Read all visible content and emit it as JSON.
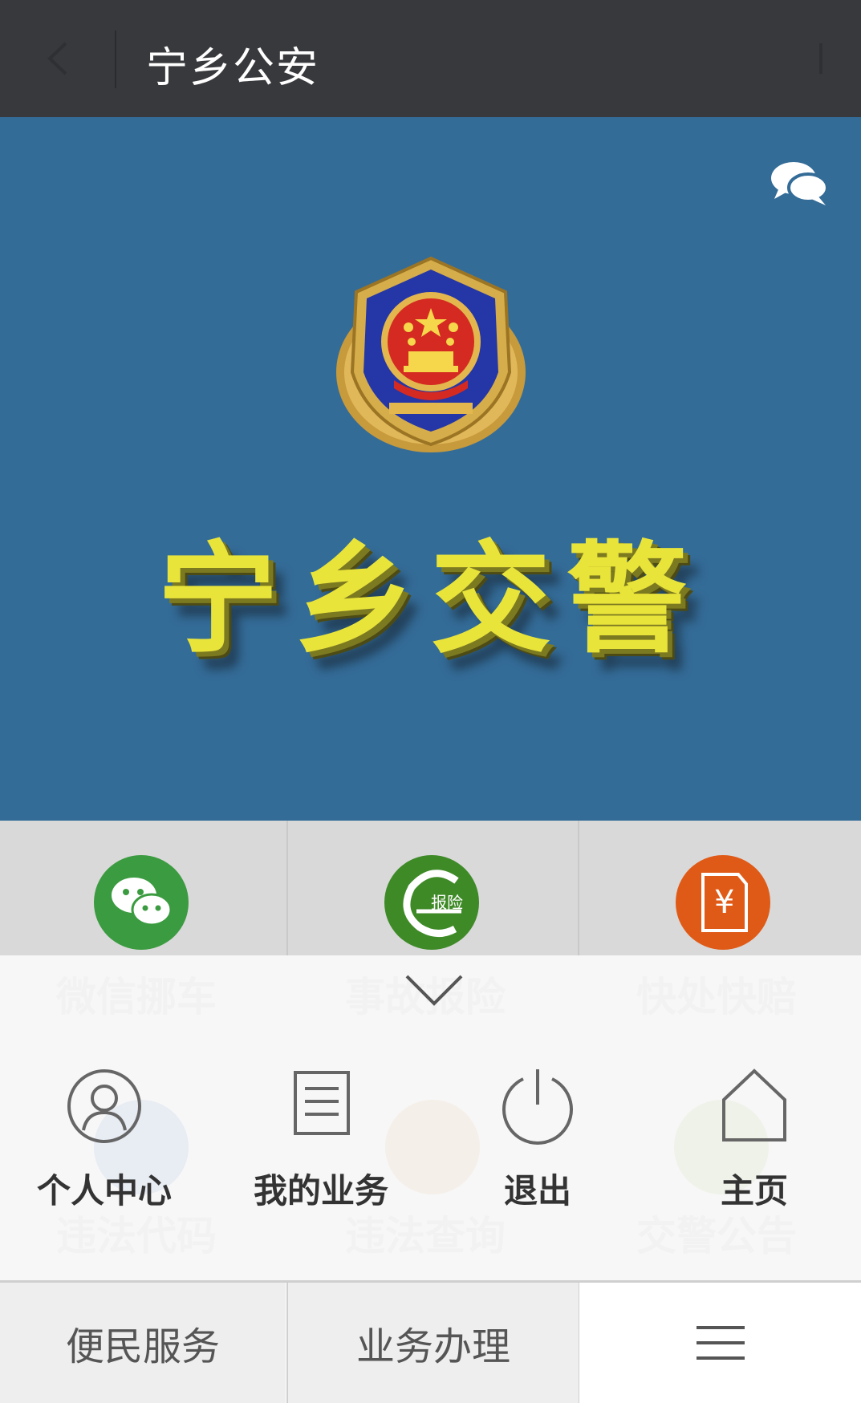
{
  "header": {
    "title": "宁乡公安"
  },
  "banner": {
    "title": "宁乡交警"
  },
  "service_grid": [
    {
      "label": "微信挪车",
      "color": "#3b9b40",
      "icon": "wechat-icon"
    },
    {
      "label": "事故报险",
      "color": "#3e8a27",
      "icon": "accident-report-icon",
      "icon_text": "报险"
    },
    {
      "label": "快处快赔",
      "color": "#e05a17",
      "icon": "payment-icon"
    }
  ],
  "service_grid_row2": [
    {
      "label": "违法代码",
      "color": "#2f63c7"
    },
    {
      "label": "违法查询",
      "color": "#e88a3a"
    },
    {
      "label": "交警公告",
      "color": "#8bb83a"
    }
  ],
  "popup_menu": [
    {
      "label": "个人中心",
      "icon": "user-icon"
    },
    {
      "label": "我的业务",
      "icon": "document-icon"
    },
    {
      "label": "退出",
      "icon": "power-icon"
    },
    {
      "label": "主页",
      "icon": "home-icon"
    }
  ],
  "bottom_nav": {
    "tab1": "便民服务",
    "tab2": "业务办理"
  }
}
